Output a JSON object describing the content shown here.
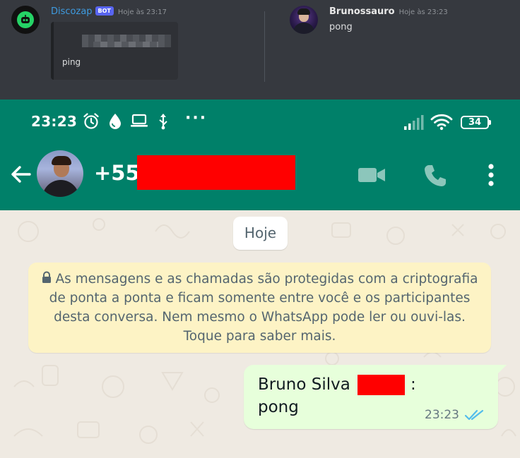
{
  "discord": {
    "left_message": {
      "author": "Discozap",
      "bot_tag": "BOT",
      "timestamp": "Hoje às 23:17",
      "embed_text": "ping"
    },
    "right_message": {
      "author": "Brunossauro",
      "timestamp": "Hoje às 23:23",
      "text": "pong"
    }
  },
  "status_bar": {
    "time": "23:23",
    "battery": "34",
    "more_indicator": "···"
  },
  "whatsapp": {
    "contact_prefix": "+55",
    "date_chip": "Hoje",
    "system_message": "As mensagens e as chamadas são protegidas com a criptografia de ponta a ponta e ficam somente entre você e os participantes desta conversa. Nem mesmo o WhatsApp pode ler ou ouvi-las. Toque para saber mais.",
    "outgoing_message": {
      "sender_prefix": "Bruno Silva",
      "colon": ":",
      "body": "pong",
      "time": "23:23",
      "status": "read"
    }
  },
  "colors": {
    "whatsapp_green": "#008069",
    "outgoing_bubble": "#e7ffdb",
    "system_bubble": "#fdf3c5",
    "chat_background": "#efeae2",
    "redaction": "#ff0000",
    "read_ticks": "#53bdeb",
    "discord_bg": "#36393f",
    "discord_bot_name": "#3e9be0"
  },
  "icons": [
    "whatsapp-bot-icon",
    "alarm-icon",
    "drop-icon",
    "laptop-icon",
    "usb-icon",
    "signal-icon",
    "wifi-icon",
    "battery-icon",
    "back-arrow-icon",
    "video-call-icon",
    "voice-call-icon",
    "more-vert-icon",
    "lock-icon",
    "double-check-icon"
  ]
}
